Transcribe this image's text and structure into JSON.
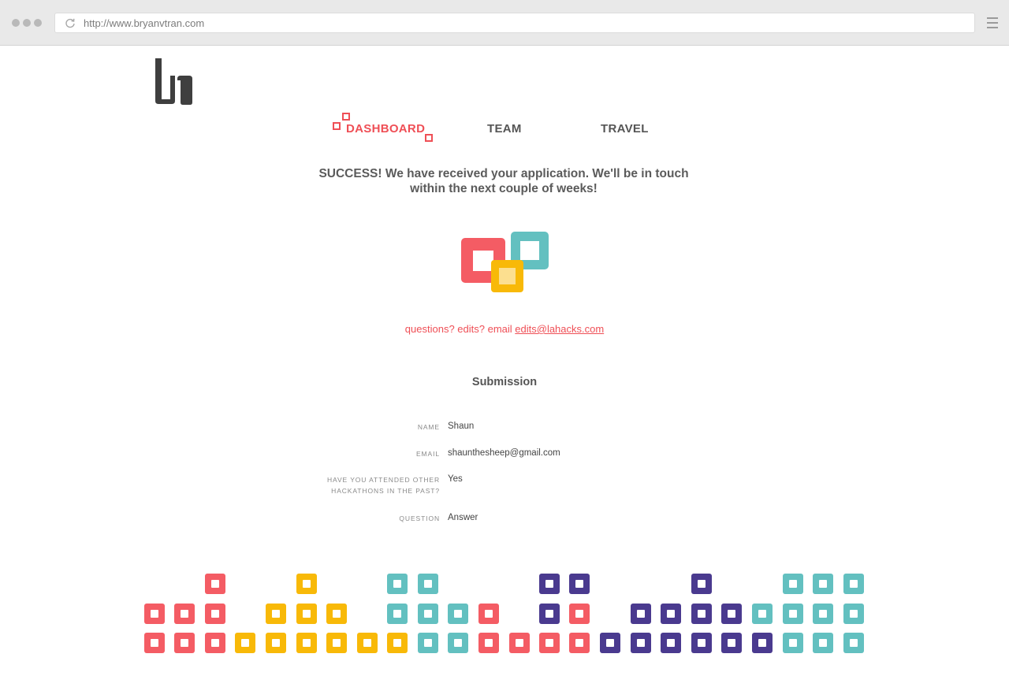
{
  "browser": {
    "url": "http://www.bryanvtran.com"
  },
  "nav": {
    "items": [
      {
        "label": "DASHBOARD",
        "active": true
      },
      {
        "label": "TEAM",
        "active": false
      },
      {
        "label": "TRAVEL",
        "active": false
      }
    ]
  },
  "status": {
    "line1": "SUCCESS! We have received your application. We'll be in touch",
    "line2": "within the next couple of weeks!"
  },
  "contact": {
    "prefix": "questions? edits? email ",
    "email": "edits@lahacks.com"
  },
  "submission": {
    "title": "Submission",
    "fields": [
      {
        "label": "NAME",
        "value": "Shaun"
      },
      {
        "label": "EMAIL",
        "value": "shaunthesheep@gmail.com"
      },
      {
        "label_line1": "HAVE YOU ATTENDED OTHER",
        "label_line2": "HACKATHONS IN THE PAST?",
        "value": "Yes"
      },
      {
        "label": "QUESTION",
        "value": "Answer"
      }
    ]
  },
  "colors": {
    "accent": "#ef4f56",
    "red": "#f45c64",
    "yellow": "#f8b908",
    "teal": "#63c0c0",
    "purple": "#4a3a8f",
    "text": "#555555"
  }
}
